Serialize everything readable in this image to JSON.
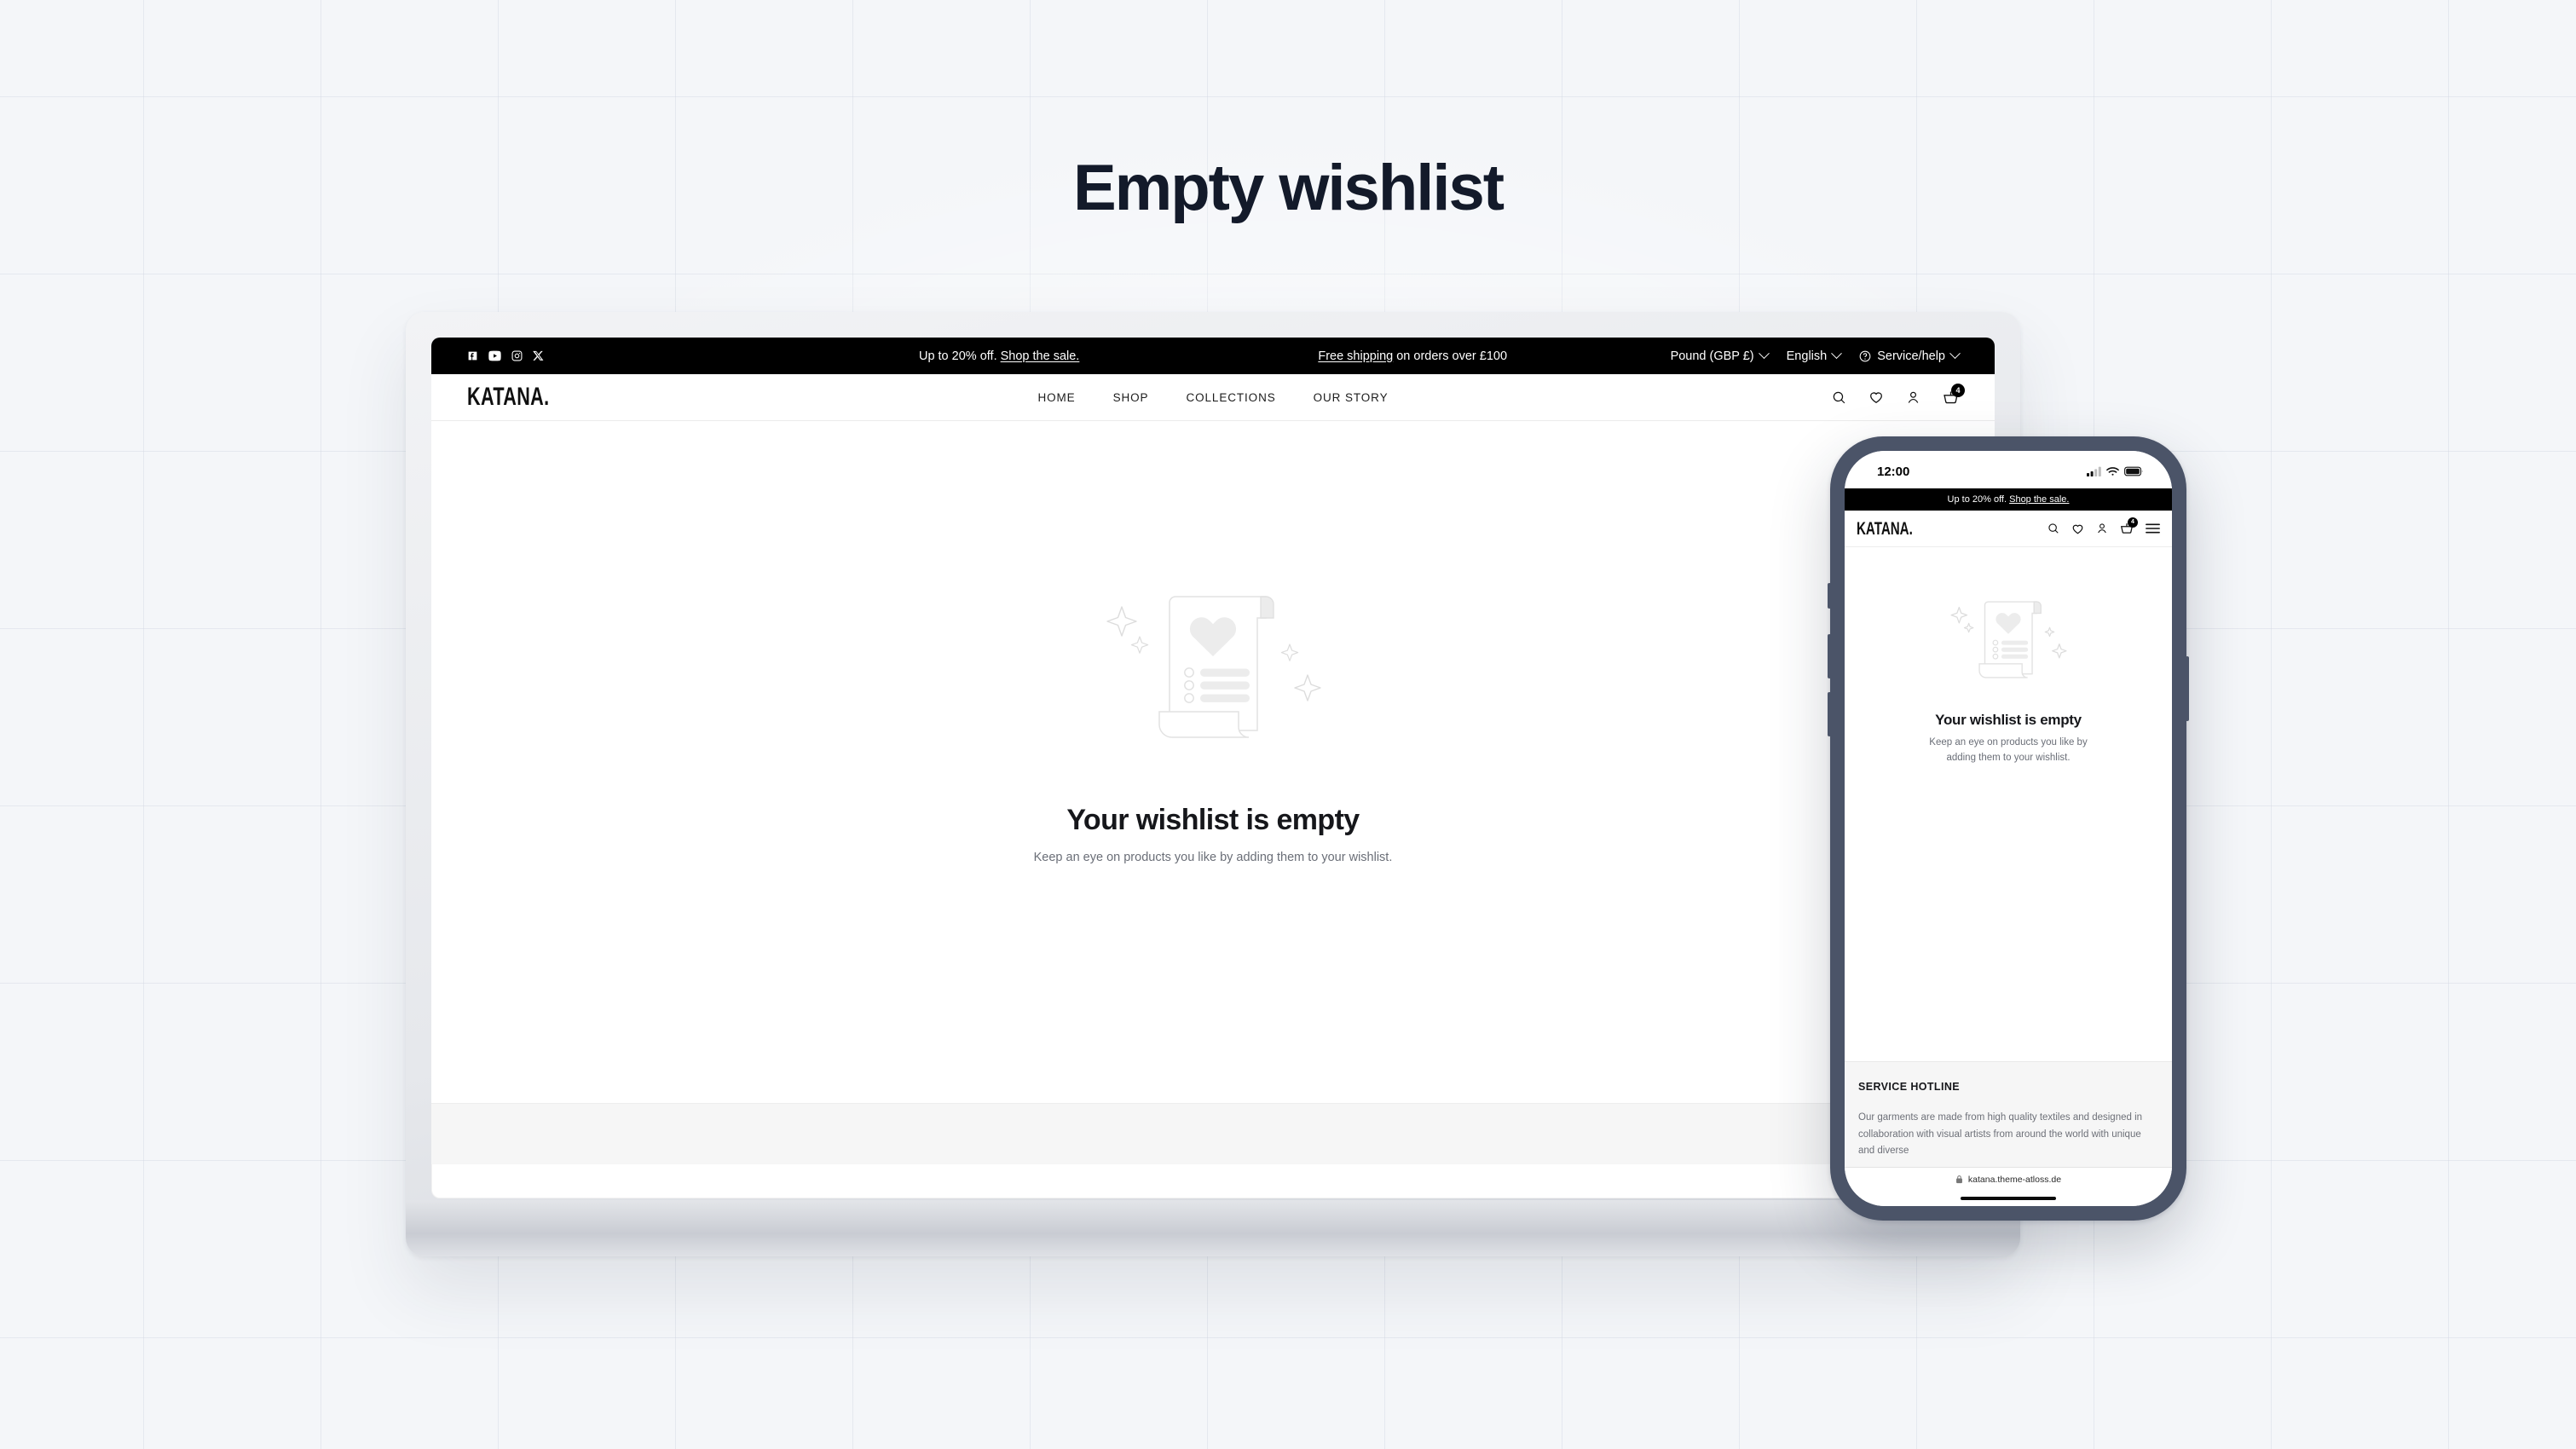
{
  "page": {
    "title": "Empty wishlist",
    "background_color": "#f4f6f9",
    "accent_color": "#131a2a"
  },
  "desktop": {
    "announcement": {
      "socials": [
        {
          "name": "facebook-icon",
          "label": "Facebook"
        },
        {
          "name": "youtube-icon",
          "label": "YouTube"
        },
        {
          "name": "instagram-icon",
          "label": "Instagram"
        },
        {
          "name": "x-icon",
          "label": "X"
        }
      ],
      "promo_text": "Up to 20% off. ",
      "promo_link": "Shop the sale.",
      "shipping_link": "Free shipping",
      "shipping_text": " on orders over £100",
      "currency": "Pound (GBP £)",
      "language": "English",
      "service": "Service/help"
    },
    "header": {
      "logo": "KATANA.",
      "nav": [
        {
          "label": "HOME"
        },
        {
          "label": "SHOP"
        },
        {
          "label": "COLLECTIONS"
        },
        {
          "label": "OUR STORY"
        }
      ],
      "icons": [
        {
          "name": "search-icon"
        },
        {
          "name": "wishlist-heart-icon"
        },
        {
          "name": "account-person-icon"
        },
        {
          "name": "cart-basket-icon"
        }
      ],
      "cart_count": "4"
    },
    "empty_state": {
      "illustration": "wishlist-scroll-illustration",
      "title": "Your wishlist is empty",
      "subtitle": "Keep an eye on products you like by adding them to your wishlist."
    }
  },
  "mobile": {
    "status_bar": {
      "time": "12:00",
      "signal_icon": "cellular-signal-icon",
      "wifi_icon": "wifi-icon",
      "battery_icon": "battery-icon"
    },
    "announcement": {
      "promo_text": "Up to 20% off. ",
      "promo_link": "Shop the sale."
    },
    "header": {
      "logo": "KATANA.",
      "cart_count": "4"
    },
    "empty_state": {
      "title": "Your wishlist is empty",
      "subtitle": "Keep an eye on products you like by adding them to your wishlist."
    },
    "footer": {
      "title": "SERVICE HOTLINE",
      "text": "Our garments are made from high quality textiles and designed in collaboration with visual artists from around the world with unique and diverse"
    },
    "url_bar": {
      "lock_icon": "lock-icon",
      "url": "katana.theme-atloss.de"
    }
  }
}
